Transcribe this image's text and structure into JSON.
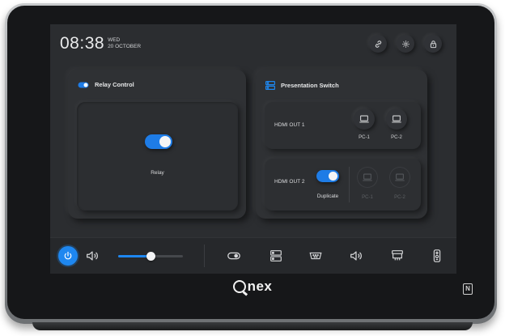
{
  "clock": {
    "time": "08:38",
    "day": "WED",
    "date": "20 OCTOBER"
  },
  "header_icons": [
    "link-icon",
    "gear-icon",
    "lock-icon"
  ],
  "relay_card": {
    "title": "Relay Control",
    "toggle_on": true,
    "relay_label": "Relay"
  },
  "presentation_card": {
    "title": "Presentation Switch",
    "hdmi_out_1": {
      "label": "HDMI OUT 1",
      "sources": [
        {
          "label": "PC-1"
        },
        {
          "label": "PC-2"
        }
      ]
    },
    "hdmi_out_2": {
      "label": "HDMI OUT 2",
      "duplicate_label": "Duplicate",
      "duplicate_on": true,
      "sources": [
        {
          "label": "PC-1",
          "disabled": true
        },
        {
          "label": "PC-2",
          "disabled": true
        }
      ]
    }
  },
  "bottom_bar": {
    "volume_level": 0.5,
    "icons": [
      "power-icon",
      "speaker-icon",
      "toggle-icon",
      "switcher-icon",
      "vga-icon",
      "audio-icon",
      "projector-screen-icon",
      "remote-icon"
    ]
  },
  "brand": {
    "name": "nex"
  },
  "colors": {
    "accent": "#1e87f0",
    "screen_bg": "#2b2d30",
    "card_bg": "#2f3134"
  }
}
